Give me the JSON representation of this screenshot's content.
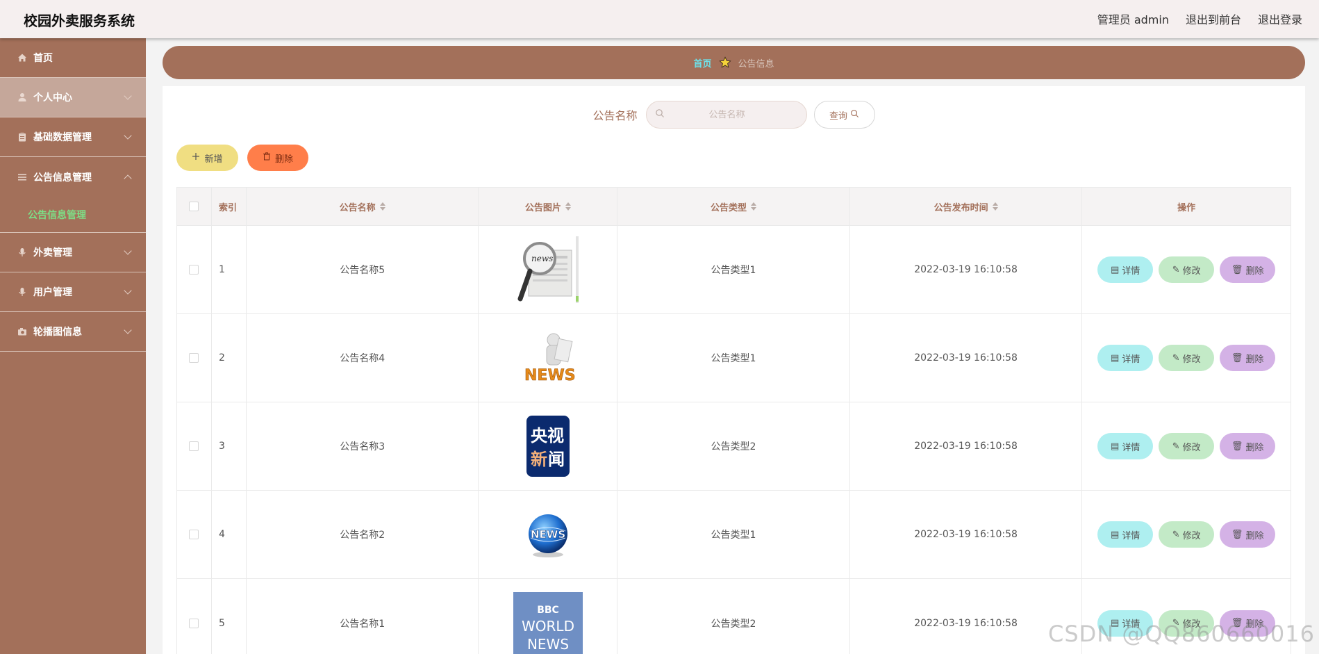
{
  "header": {
    "title": "校园外卖服务系统",
    "user_label": "管理员 admin",
    "to_front": "退出到前台",
    "logout": "退出登录"
  },
  "sidebar": {
    "items": [
      {
        "label": "首页",
        "icon": "home-icon"
      },
      {
        "label": "个人中心",
        "icon": "user-icon"
      },
      {
        "label": "基础数据管理",
        "icon": "clipboard-icon"
      },
      {
        "label": "公告信息管理",
        "icon": "list-icon"
      },
      {
        "label": "外卖管理",
        "icon": "mic-icon"
      },
      {
        "label": "用户管理",
        "icon": "mic-icon"
      },
      {
        "label": "轮播图信息",
        "icon": "camera-icon"
      }
    ],
    "submenu": {
      "label": "公告信息管理"
    }
  },
  "breadcrumb": {
    "home": "首页",
    "current": "公告信息"
  },
  "search": {
    "label": "公告名称",
    "placeholder": "公告名称",
    "button": "查询"
  },
  "actions": {
    "add": "新增",
    "delete": "删除"
  },
  "table": {
    "headers": {
      "index": "索引",
      "name": "公告名称",
      "image": "公告图片",
      "type": "公告类型",
      "time": "公告发布时间",
      "ops": "操作"
    },
    "rows": [
      {
        "index": "1",
        "name": "公告名称5",
        "type": "公告类型1",
        "time": "2022-03-19 16:10:58",
        "image": "news-magnifier"
      },
      {
        "index": "2",
        "name": "公告名称4",
        "type": "公告类型1",
        "time": "2022-03-19 16:10:58",
        "image": "news-figure"
      },
      {
        "index": "3",
        "name": "公告名称3",
        "type": "公告类型2",
        "time": "2022-03-19 16:10:58",
        "image": "cctv-news"
      },
      {
        "index": "4",
        "name": "公告名称2",
        "type": "公告类型1",
        "time": "2022-03-19 16:10:58",
        "image": "news-globe"
      },
      {
        "index": "5",
        "name": "公告名称1",
        "type": "公告类型2",
        "time": "2022-03-19 16:10:58",
        "image": "bbc-world-news"
      }
    ],
    "op_labels": {
      "detail": "详情",
      "edit": "修改",
      "remove": "删除"
    }
  },
  "images": {
    "cctv": {
      "line1": "央视",
      "line2_a": "新",
      "line2_b": "闻"
    },
    "bbc": {
      "line1": "BBC",
      "line2": "WORLD",
      "line3": "NEWS"
    },
    "globe": {
      "text": "NEWS"
    },
    "figure": {
      "text": "NEWS"
    },
    "magnifier": {
      "text": "news"
    }
  },
  "watermark": "CSDN @QQ860660016",
  "colors": {
    "brand": "#a3705a",
    "header_bg": "#f5efef",
    "submenu_active": "#7dde86",
    "breadcrumb_home": "#6ee0e8",
    "btn_add": "#f0de82",
    "btn_delete": "#ff7e4a",
    "op_detail": "#aeeff0",
    "op_edit": "#c3eac7",
    "op_remove": "#d4b2e6"
  }
}
